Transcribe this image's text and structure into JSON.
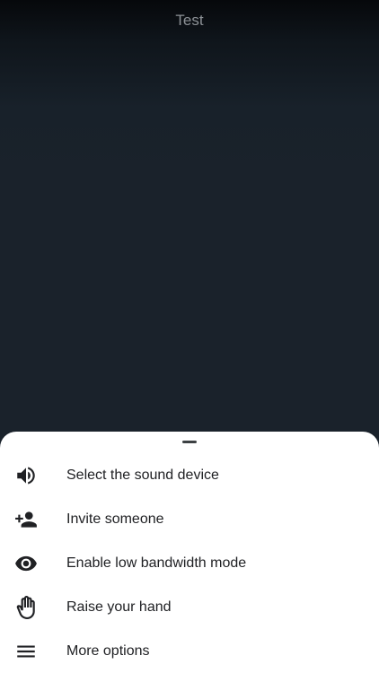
{
  "header": {
    "title": "Test"
  },
  "sheet": {
    "items": [
      {
        "label": "Select the sound device",
        "icon": "volume-icon"
      },
      {
        "label": "Invite someone",
        "icon": "person-add-icon"
      },
      {
        "label": "Enable low bandwidth mode",
        "icon": "eye-icon"
      },
      {
        "label": "Raise your hand",
        "icon": "hand-icon"
      },
      {
        "label": "More options",
        "icon": "menu-icon"
      }
    ]
  },
  "colors": {
    "background": "#1a222b",
    "sheet": "#ffffff",
    "text": "#202124",
    "title": "#8c9196"
  }
}
